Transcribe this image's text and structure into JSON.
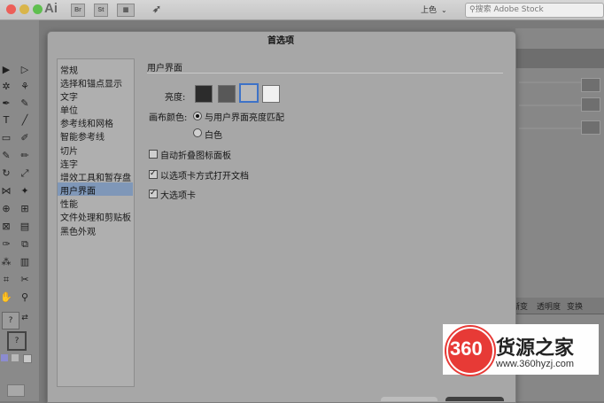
{
  "app": {
    "logo_text": "Ai",
    "bridge_label": "Br",
    "stock_label": "St"
  },
  "workspace": {
    "value": "上色"
  },
  "search": {
    "placeholder": "搜索 Adobe Stock"
  },
  "dialog": {
    "title": "首选项",
    "sidebar": [
      "常规",
      "选择和锚点显示",
      "文字",
      "单位",
      "参考线和网格",
      "智能参考线",
      "切片",
      "连字",
      "增效工具和暂存盘",
      "用户界面",
      "性能",
      "文件处理和剪贴板",
      "黑色外观"
    ],
    "selected": "用户界面",
    "section_title": "用户界面",
    "brightness_label": "亮度:",
    "brightness_swatches": [
      "#2c2c2c",
      "#585858",
      "#b9b9b9",
      "#f0f0f0"
    ],
    "brightness_selected_index": 2,
    "canvas_label": "画布颜色:",
    "canvas_options": [
      "与用户界面亮度匹配",
      "白色"
    ],
    "canvas_selected_index": 0,
    "checkboxes": [
      {
        "label": "自动折叠图标面板",
        "checked": false
      },
      {
        "label": "以选项卡方式打开文档",
        "checked": true
      },
      {
        "label": "大选项卡",
        "checked": true
      }
    ]
  },
  "right_panel": {
    "tabs": [
      "渐变",
      "透明度",
      "变换"
    ]
  },
  "watermark": {
    "number": "360",
    "name": "货源之家",
    "url": "www.360hyzj.com"
  }
}
